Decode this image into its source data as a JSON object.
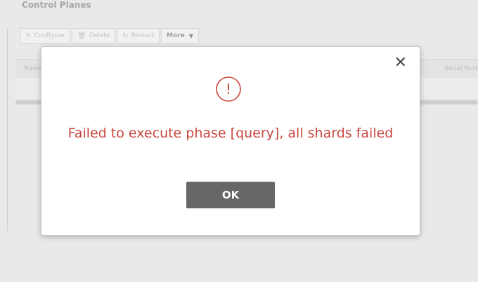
{
  "page": {
    "section_title": "Control Planes"
  },
  "toolbar": {
    "buttons": [
      {
        "label": "Configure",
        "icon": "pencil-icon"
      },
      {
        "label": "Delete",
        "icon": "trash-icon"
      },
      {
        "label": "Restart",
        "icon": "restart-icon"
      },
      {
        "label": "More",
        "icon": "chevron-down-icon"
      }
    ]
  },
  "grid": {
    "columns": [
      "Name",
      "Serial Number"
    ]
  },
  "dialog": {
    "message": "Failed to execute phase [query], all shards failed",
    "ok_label": "OK",
    "alert_glyph": "!",
    "accent_color": "#c8483f"
  }
}
